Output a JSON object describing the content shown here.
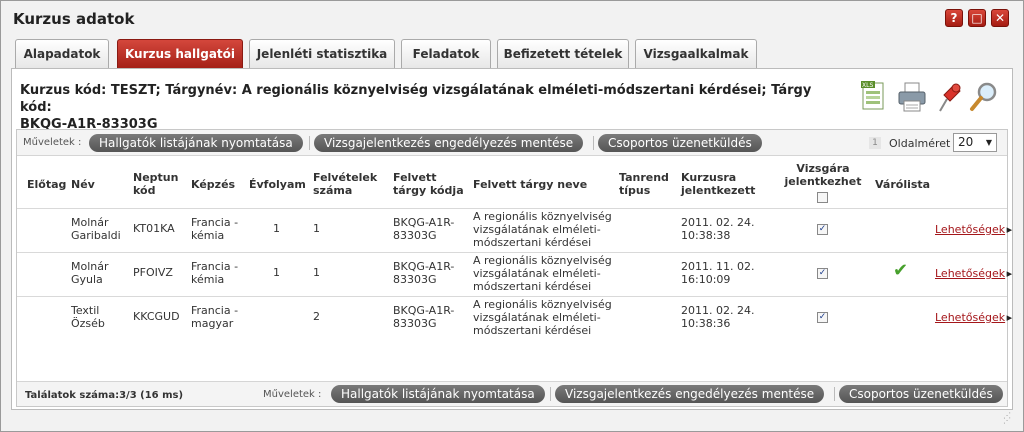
{
  "window": {
    "title": "Kurzus adatok",
    "buttons": [
      "?",
      "□",
      "✕"
    ]
  },
  "tabs": [
    {
      "label": "Alapadatok",
      "active": false
    },
    {
      "label": "Kurzus hallgatói",
      "active": true
    },
    {
      "label": "Jelenléti statisztika",
      "active": false
    },
    {
      "label": "Feladatok",
      "active": false
    },
    {
      "label": "Befizetett tételek",
      "active": false
    },
    {
      "label": "Vizsgaalkalmak",
      "active": false
    }
  ],
  "course": {
    "line1": "Kurzus kód: TESZT; Tárgynév: A regionális köznyelviség vizsgálatának elméleti-módszertani kérdései; Tárgy kód:",
    "line2": "BKQG-A1R-83303G"
  },
  "tools": [
    "excel-icon",
    "printer-icon",
    "pin-icon",
    "magnifier-icon"
  ],
  "toolbar": {
    "label": "Műveletek :",
    "actions": [
      "Hallgatók listájának nyomtatása",
      "Vizsgajelentkezés engedélyezés mentése",
      "Csoportos üzenetküldés"
    ],
    "page_number": "1",
    "page_size_label": "Oldalméret",
    "page_size": "20"
  },
  "columns": {
    "elotag": "Előtag",
    "nev": "Név",
    "neptun": [
      "Neptun",
      "kód"
    ],
    "kepzes": "Képzés",
    "evfolyam": "Évfolyam",
    "felvetelek": [
      "Felvételek",
      "száma"
    ],
    "felvett_kod": [
      "Felvett",
      "tárgy kódja"
    ],
    "felvett_nev": "Felvett tárgy neve",
    "tanrend": [
      "Tanrend",
      "típus"
    ],
    "kurzusra": [
      "Kurzusra",
      "jelentkezett"
    ],
    "vizsgara": [
      "Vizsgára",
      "jelentkezhet"
    ],
    "varolista": "Várólista"
  },
  "rows": [
    {
      "nev": [
        "Molnár",
        "Garibaldi"
      ],
      "neptun": "KT01KA",
      "kepzes": [
        "Francia -",
        "kémia"
      ],
      "evfolyam": "1",
      "felvetelek": "1",
      "kod": [
        "BKQG-A1R-",
        "83303G"
      ],
      "targy": [
        "A regionális köznyelviség",
        "vizsgálatának elméleti-",
        "módszertani kérdései"
      ],
      "jelentkezett": [
        "2011. 02. 24.",
        "10:38:38"
      ],
      "vizsgara": true,
      "varolista": false,
      "link": "Lehetőségek"
    },
    {
      "nev": [
        "Molnár",
        "Gyula"
      ],
      "neptun": "PFOIVZ",
      "kepzes": [
        "Francia -",
        "kémia"
      ],
      "evfolyam": "1",
      "felvetelek": "1",
      "kod": [
        "BKQG-A1R-",
        "83303G"
      ],
      "targy": [
        "A regionális köznyelviség",
        "vizsgálatának elméleti-",
        "módszertani kérdései"
      ],
      "jelentkezett": [
        "2011. 11. 02.",
        "16:10:09"
      ],
      "vizsgara": true,
      "varolista": true,
      "link": "Lehetőségek"
    },
    {
      "nev": [
        "Textil",
        "Özséb"
      ],
      "neptun": "KKCGUD",
      "kepzes": [
        "Francia -",
        "magyar"
      ],
      "evfolyam": "",
      "felvetelek": "2",
      "kod": [
        "BKQG-A1R-",
        "83303G"
      ],
      "targy": [
        "A regionális köznyelviség",
        "vizsgálatának elméleti-",
        "módszertani kérdései"
      ],
      "jelentkezett": [
        "2011. 02. 24.",
        "10:38:36"
      ],
      "vizsgara": true,
      "varolista": false,
      "link": "Lehetőségek"
    }
  ],
  "footer": {
    "found": "Találatok száma:3/3 (16 ms)"
  },
  "colors": {
    "accent": "#b3261e",
    "button": "#666666",
    "link": "#a4161a",
    "check": "#47a02c"
  }
}
